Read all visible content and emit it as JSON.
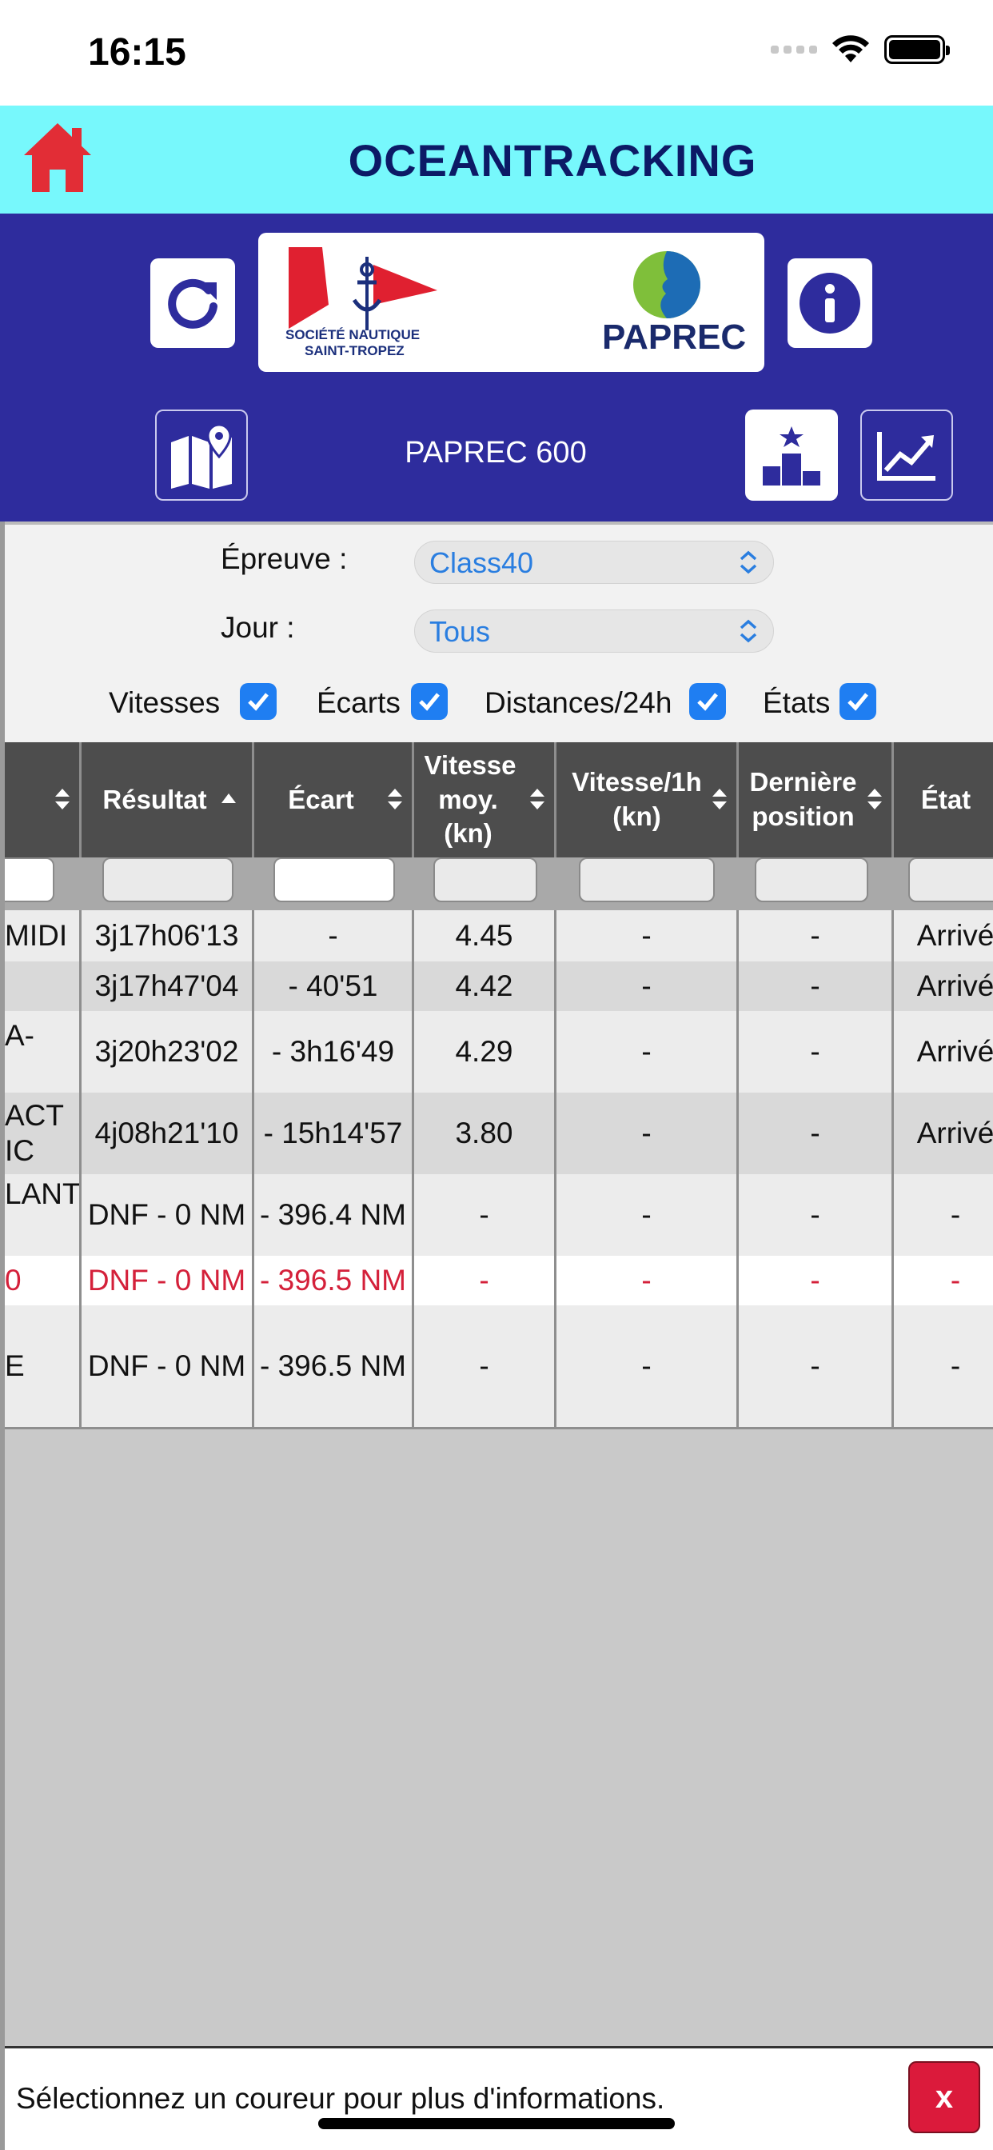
{
  "status_bar": {
    "time": "16:15",
    "icons": [
      "signal-dots-icon",
      "wifi-icon",
      "battery-icon"
    ]
  },
  "header": {
    "title": "OCEANTRACKING",
    "race_name": "PAPREC 600",
    "logos": {
      "club_text_1": "SOCIÉTÉ NAUTIQUE",
      "club_text_2": "SAINT-TROPEZ",
      "sponsor": "PAPREC"
    },
    "colors": {
      "top_bar": "#77f8fc",
      "panel": "#2e2c9d",
      "title": "#0c1a66"
    }
  },
  "filters": {
    "epreuve_label": "Épreuve :",
    "epreuve_value": "Class40",
    "jour_label": "Jour :",
    "jour_value": "Tous",
    "checkboxes": [
      {
        "label": "Vitesses",
        "checked": true
      },
      {
        "label": "Écarts",
        "checked": true
      },
      {
        "label": "Distances/24h",
        "checked": true
      },
      {
        "label": "États",
        "checked": true
      }
    ]
  },
  "table": {
    "headers": [
      {
        "label": ""
      },
      {
        "label": "Résultat"
      },
      {
        "label": "Écart"
      },
      {
        "label": "Vitesse moy. (kn)"
      },
      {
        "label": "Vitesse/1h (kn)"
      },
      {
        "label": "Dernière position"
      },
      {
        "label": "État"
      }
    ],
    "rows": [
      {
        "cells": [
          "MIDI",
          "3j17h06'13",
          "-",
          "4.45",
          "-",
          "-",
          "Arrivé"
        ],
        "highlight": false
      },
      {
        "cells": [
          "",
          "3j17h47'04",
          "- 40'51",
          "4.42",
          "-",
          "-",
          "Arrivé"
        ],
        "highlight": false
      },
      {
        "cells": [
          "A-",
          "3j20h23'02",
          "- 3h16'49",
          "4.29",
          "-",
          "-",
          "Arrivé"
        ],
        "highlight": false
      },
      {
        "cells": [
          "ACT\nIC",
          "4j08h21'10",
          "- 15h14'57",
          "3.80",
          "-",
          "-",
          "Arrivé"
        ],
        "highlight": false
      },
      {
        "cells": [
          "LANT",
          "DNF - 0 NM",
          "- 396.4 NM",
          "-",
          "-",
          "-",
          "-"
        ],
        "highlight": false
      },
      {
        "cells": [
          "0",
          "DNF - 0 NM",
          "- 396.5 NM",
          "-",
          "-",
          "-",
          "-"
        ],
        "highlight": true
      },
      {
        "cells": [
          "E",
          "DNF - 0 NM",
          "- 396.5 NM",
          "-",
          "-",
          "-",
          "-"
        ],
        "highlight": false
      }
    ]
  },
  "bottom": {
    "message": "Sélectionnez un coureur pour plus d'informations.",
    "close_label": "x"
  }
}
